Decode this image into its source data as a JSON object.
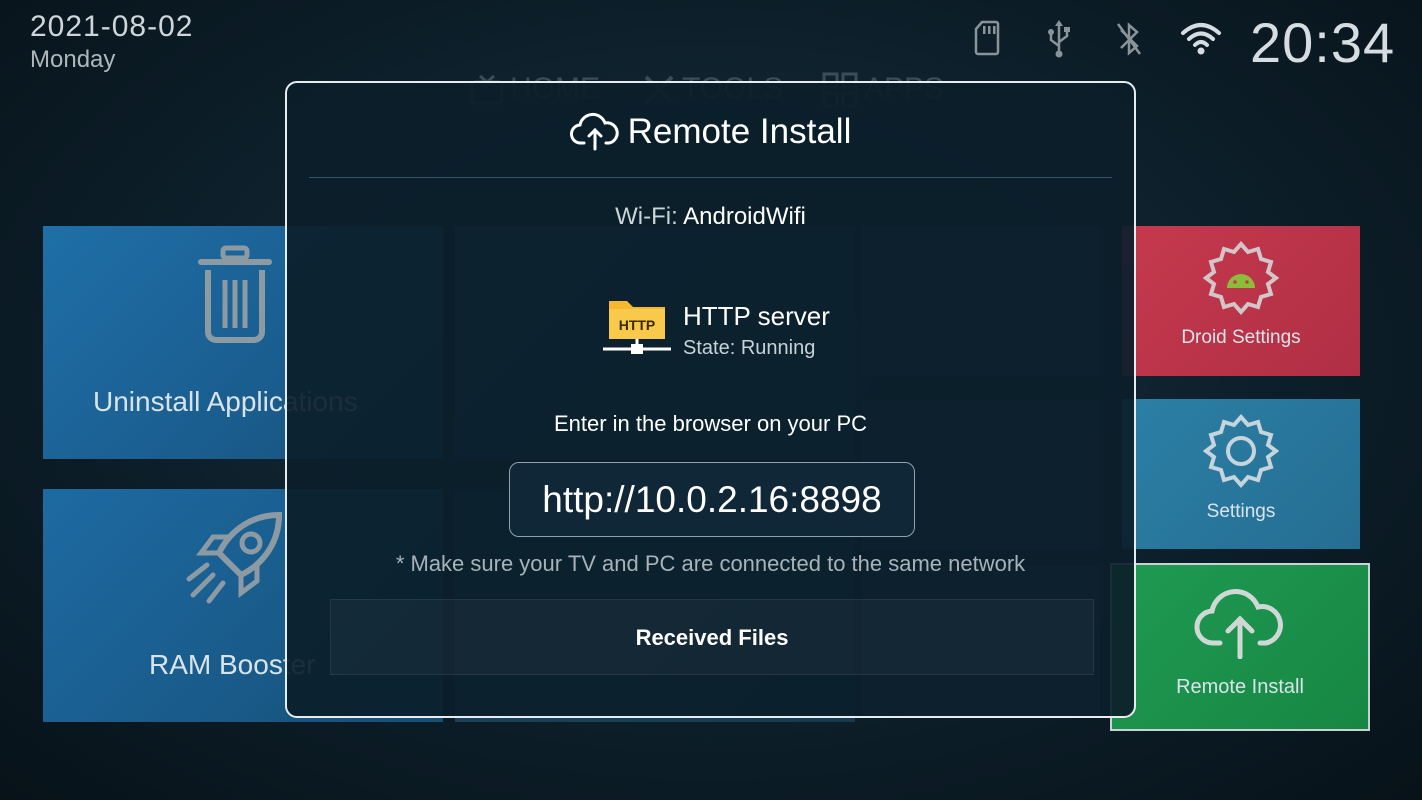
{
  "status_bar": {
    "date": "2021-08-02",
    "weekday": "Monday",
    "time": "20:34",
    "icons": [
      "sd-card-icon",
      "usb-icon",
      "bluetooth-off-icon",
      "wifi-icon"
    ]
  },
  "nav": {
    "tabs": [
      {
        "label": "HOME",
        "icon": "tv-icon"
      },
      {
        "label": "TOOLS",
        "icon": "tools-icon"
      },
      {
        "label": "APPS",
        "icon": "apps-grid-icon"
      }
    ]
  },
  "tiles": {
    "uninstall": {
      "label": "Uninstall Applications",
      "icon": "trash-icon",
      "color": "#1f6fa8"
    },
    "ram_booster": {
      "label": "RAM Booster",
      "icon": "rocket-icon",
      "color": "#1d6aa2"
    },
    "droid_settings": {
      "label": "Droid Settings",
      "icon": "android-gear-icon",
      "color": "#c6394e"
    },
    "settings": {
      "label": "Settings",
      "icon": "gear-icon",
      "color": "#2c7fa6"
    },
    "remote_install": {
      "label": "Remote Install",
      "icon": "cloud-upload-icon",
      "color": "#1f9a52"
    }
  },
  "dialog": {
    "title": "Remote Install",
    "title_icon": "cloud-upload-icon",
    "wifi_label": "Wi-Fi:",
    "wifi_name": "AndroidWifi",
    "server_name": "HTTP server",
    "server_state": "State: Running",
    "server_icon_text": "HTTP",
    "instruction": "Enter in the browser on your PC",
    "url": "http://10.0.2.16:8898",
    "note": "* Make sure your TV and PC are connected to the same network",
    "received_button": "Received Files"
  },
  "colors": {
    "background": "#0d1f2a",
    "dialog_border": "#e6ecef",
    "folder_yellow": "#f5b82e"
  }
}
